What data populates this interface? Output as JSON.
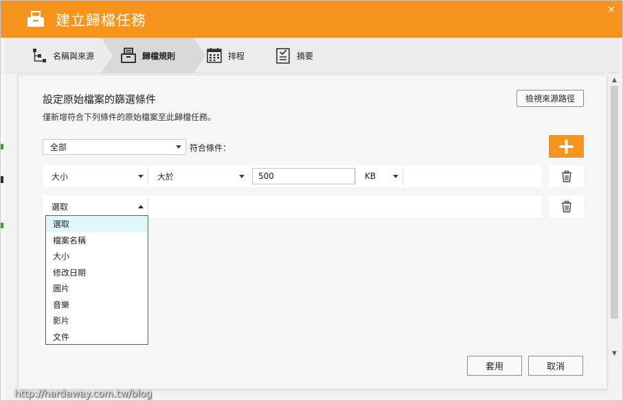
{
  "window": {
    "title": "建立歸檔任務",
    "close_glyph": "×"
  },
  "steps": [
    {
      "label": "名稱與來源",
      "icon": "hierarchy-icon"
    },
    {
      "label": "歸檔規則",
      "icon": "archive-box-icon",
      "active": true
    },
    {
      "label": "排程",
      "icon": "calendar-icon"
    },
    {
      "label": "摘要",
      "icon": "checklist-icon"
    }
  ],
  "panel": {
    "heading": "設定原始檔案的篩選條件",
    "subheading": "僅新增符合下列條件的原始檔案至此歸檔任務。",
    "view_source_label": "檢視來源路徑",
    "match_select_value": "全部",
    "match_label": "符合條件：",
    "add_glyph": "+"
  },
  "rule1": {
    "field": "大小",
    "operator": "大於",
    "value": "500",
    "unit": "KB"
  },
  "rule2": {
    "field": "選取"
  },
  "dropdown": {
    "options": [
      "選取",
      "檔案名稱",
      "大小",
      "修改日期",
      "圖片",
      "音樂",
      "影片",
      "文件"
    ],
    "selected_index": 0
  },
  "buttons": {
    "apply": "套用",
    "cancel": "取消"
  },
  "watermark": "http://hardaway.com.tw/blog",
  "colors": {
    "accent": "#f7941d",
    "dropdown_highlight": "#e0f7fb"
  }
}
